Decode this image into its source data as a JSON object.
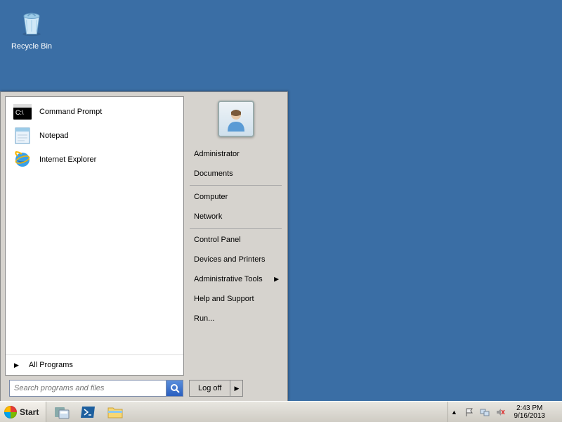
{
  "desktop": {
    "recycle_bin_label": "Recycle Bin"
  },
  "start_menu": {
    "left_items": [
      {
        "label": "Command Prompt",
        "icon": "cmd"
      },
      {
        "label": "Notepad",
        "icon": "notepad"
      },
      {
        "label": "Internet Explorer",
        "icon": "ie"
      }
    ],
    "all_programs_label": "All Programs",
    "right_items": [
      {
        "label": "Administrator",
        "sep_after": false
      },
      {
        "label": "Documents",
        "sep_after": true
      },
      {
        "label": "Computer",
        "sep_after": false
      },
      {
        "label": "Network",
        "sep_after": true
      },
      {
        "label": "Control Panel",
        "sep_after": false
      },
      {
        "label": "Devices and Printers",
        "sep_after": false
      },
      {
        "label": "Administrative Tools",
        "submenu": true,
        "sep_after": false
      },
      {
        "label": "Help and Support",
        "sep_after": false
      },
      {
        "label": "Run...",
        "sep_after": false
      }
    ],
    "search_placeholder": "Search programs and files",
    "logoff_label": "Log off"
  },
  "taskbar": {
    "start_label": "Start",
    "time": "2:43 PM",
    "date": "9/16/2013"
  }
}
